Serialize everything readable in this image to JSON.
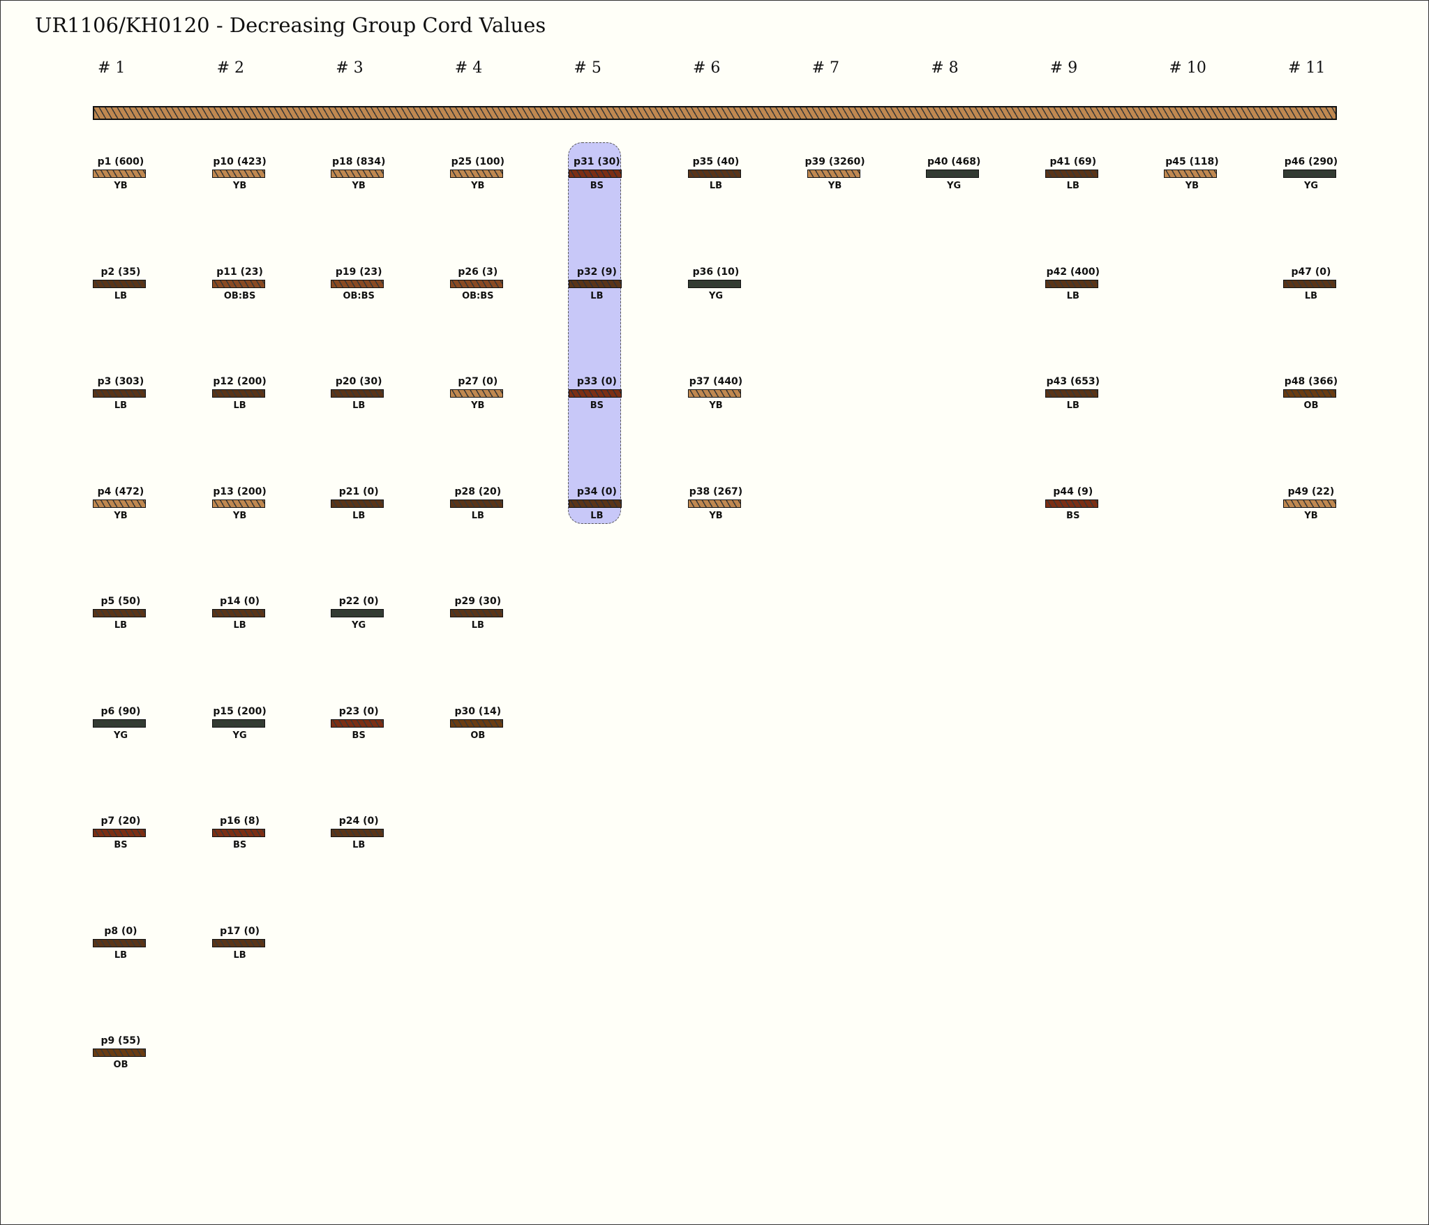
{
  "title": "UR1106/KH0120 - Decreasing Group Cord Values",
  "primary_cord_color": "YB",
  "palette": {
    "YB": "#c08850",
    "LB": "#5a3418",
    "OB:BS": "#8a4a22",
    "BS": "#7c2e14",
    "YG": "#323c32",
    "OB": "#6a3c12"
  },
  "highlight_group": 5,
  "groups": [
    {
      "label": "# 1",
      "pendants": [
        {
          "label": "p1 (600)",
          "color": "YB"
        },
        {
          "label": "p2 (35)",
          "color": "LB"
        },
        {
          "label": "p3 (303)",
          "color": "LB"
        },
        {
          "label": "p4 (472)",
          "color": "YB"
        },
        {
          "label": "p5 (50)",
          "color": "LB"
        },
        {
          "label": "p6 (90)",
          "color": "YG"
        },
        {
          "label": "p7 (20)",
          "color": "BS"
        },
        {
          "label": "p8 (0)",
          "color": "LB"
        },
        {
          "label": "p9 (55)",
          "color": "OB"
        }
      ]
    },
    {
      "label": "# 2",
      "pendants": [
        {
          "label": "p10 (423)",
          "color": "YB"
        },
        {
          "label": "p11 (23)",
          "color": "OB:BS"
        },
        {
          "label": "p12 (200)",
          "color": "LB"
        },
        {
          "label": "p13 (200)",
          "color": "YB"
        },
        {
          "label": "p14 (0)",
          "color": "LB"
        },
        {
          "label": "p15 (200)",
          "color": "YG"
        },
        {
          "label": "p16 (8)",
          "color": "BS"
        },
        {
          "label": "p17 (0)",
          "color": "LB"
        }
      ]
    },
    {
      "label": "# 3",
      "pendants": [
        {
          "label": "p18 (834)",
          "color": "YB"
        },
        {
          "label": "p19 (23)",
          "color": "OB:BS"
        },
        {
          "label": "p20 (30)",
          "color": "LB"
        },
        {
          "label": "p21 (0)",
          "color": "LB"
        },
        {
          "label": "p22 (0)",
          "color": "YG"
        },
        {
          "label": "p23 (0)",
          "color": "BS"
        },
        {
          "label": "p24 (0)",
          "color": "LB"
        }
      ]
    },
    {
      "label": "# 4",
      "pendants": [
        {
          "label": "p25 (100)",
          "color": "YB"
        },
        {
          "label": "p26 (3)",
          "color": "OB:BS"
        },
        {
          "label": "p27 (0)",
          "color": "YB"
        },
        {
          "label": "p28 (20)",
          "color": "LB"
        },
        {
          "label": "p29 (30)",
          "color": "LB"
        },
        {
          "label": "p30 (14)",
          "color": "OB"
        }
      ]
    },
    {
      "label": "# 5",
      "pendants": [
        {
          "label": "p31 (30)",
          "color": "BS"
        },
        {
          "label": "p32 (9)",
          "color": "LB"
        },
        {
          "label": "p33 (0)",
          "color": "BS"
        },
        {
          "label": "p34 (0)",
          "color": "LB"
        }
      ]
    },
    {
      "label": "# 6",
      "pendants": [
        {
          "label": "p35 (40)",
          "color": "LB"
        },
        {
          "label": "p36 (10)",
          "color": "YG"
        },
        {
          "label": "p37 (440)",
          "color": "YB"
        },
        {
          "label": "p38 (267)",
          "color": "YB"
        }
      ]
    },
    {
      "label": "# 7",
      "pendants": [
        {
          "label": "p39 (3260)",
          "color": "YB"
        }
      ]
    },
    {
      "label": "# 8",
      "pendants": [
        {
          "label": "p40 (468)",
          "color": "YG"
        }
      ]
    },
    {
      "label": "# 9",
      "pendants": [
        {
          "label": "p41 (69)",
          "color": "LB"
        },
        {
          "label": "p42 (400)",
          "color": "LB"
        },
        {
          "label": "p43 (653)",
          "color": "LB"
        },
        {
          "label": "p44 (9)",
          "color": "BS"
        }
      ]
    },
    {
      "label": "# 10",
      "pendants": [
        {
          "label": "p45 (118)",
          "color": "YB"
        }
      ]
    },
    {
      "label": "# 11",
      "pendants": [
        {
          "label": "p46 (290)",
          "color": "YG"
        },
        {
          "label": "p47 (0)",
          "color": "LB"
        },
        {
          "label": "p48 (366)",
          "color": "OB"
        },
        {
          "label": "p49 (22)",
          "color": "YB"
        }
      ]
    }
  ]
}
